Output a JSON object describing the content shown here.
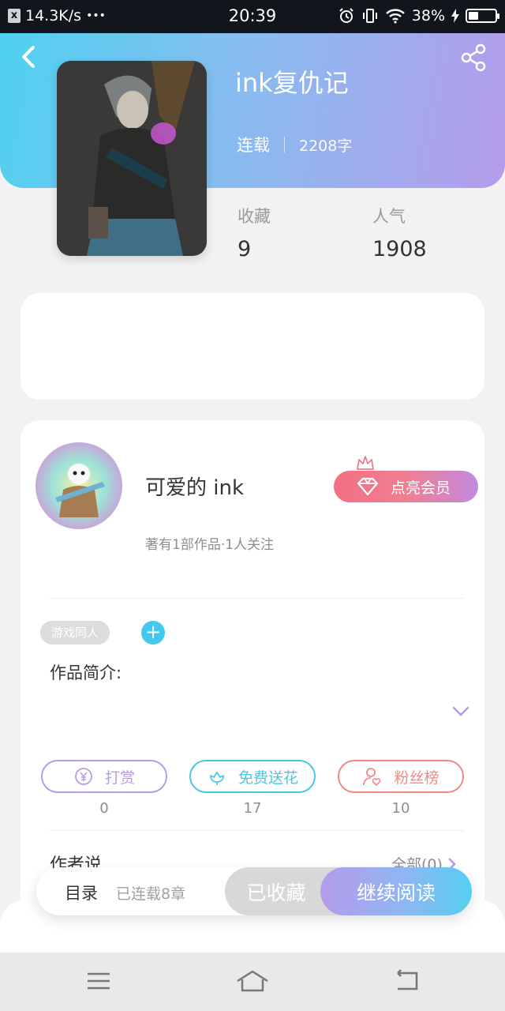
{
  "status_bar": {
    "speed": "14.3K/s",
    "dots": "•••",
    "time": "20:39",
    "battery": "38%",
    "battery_level": 0.38
  },
  "book": {
    "title": "ink复仇记",
    "status": "连载",
    "word_count": "2208字",
    "stats": [
      {
        "label": "收藏",
        "value": "9"
      },
      {
        "label": "人气",
        "value": "1908"
      }
    ]
  },
  "author": {
    "name": "可爱的 ink",
    "meta": "著有1部作品·1人关注",
    "vip_label": "点亮会员",
    "tag": "游戏同人",
    "tag_add": "+",
    "intro_label": "作品简介:"
  },
  "actions": [
    {
      "label": "打赏",
      "count": "0",
      "color": "#b79de8",
      "icon": "yen-coin-icon"
    },
    {
      "label": "免费送花",
      "count": "17",
      "color": "#47c8e8",
      "icon": "flower-icon"
    },
    {
      "label": "粉丝榜",
      "count": "10",
      "color": "#ee8a84",
      "icon": "fan-user-icon"
    }
  ],
  "author_say": {
    "label": "作者说",
    "all": "全部(0)"
  },
  "bottom_bar": {
    "catalog": "目录",
    "catalog_count": "已连载8章",
    "collected": "已收藏",
    "continue": "继续阅读"
  },
  "colors": {
    "header_start": "#4fd1f0",
    "header_end": "#b59cec",
    "accent_blue": "#43c9ee",
    "vip_pink": "#f36f83"
  }
}
